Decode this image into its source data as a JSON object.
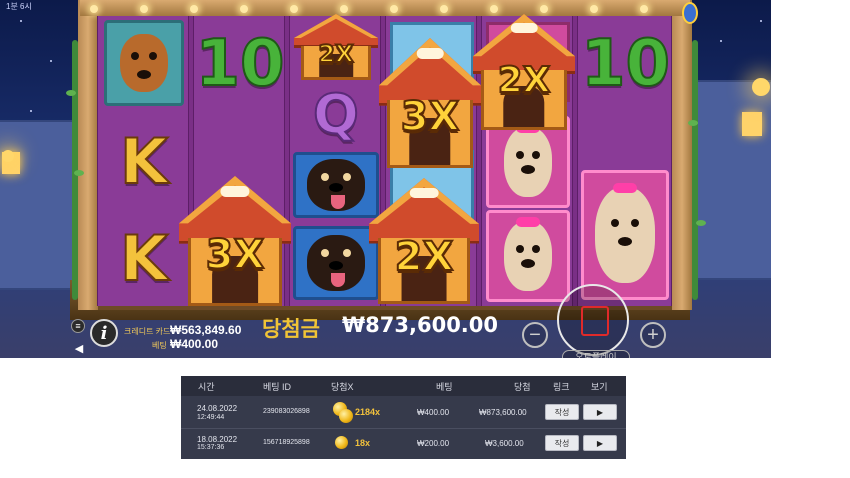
{
  "game": {
    "time_label": "1분 6시",
    "symbols": {
      "ten": "10",
      "k": "K",
      "q": "Q"
    },
    "multipliers": {
      "m2x": "2X",
      "m3x": "3X"
    },
    "hud": {
      "credit_label": "크레디트 카드",
      "credit_value": "₩563,849.60",
      "bet_label": "베팅",
      "bet_value": "₩400.00",
      "win_label": "당첨금",
      "win_value": "₩873,600.00",
      "autoplay_label": "오토플레이",
      "minus": "−",
      "plus": "+",
      "info": "i",
      "menu": "≡",
      "sound": "◀"
    }
  },
  "history": {
    "headers": {
      "time": "시간",
      "bet_id": "베팅 ID",
      "win_x": "당첨X",
      "bet": "베팅",
      "win": "당첨",
      "link": "링크",
      "view": "보기"
    },
    "rows": [
      {
        "date": "24.08.2022",
        "time": "12:49:44",
        "bet_id": "239083026898",
        "multiplier": "2184x",
        "bet": "₩400.00",
        "win": "₩873,600.00",
        "link_label": "작성",
        "view_label": "▶"
      },
      {
        "date": "18.08.2022",
        "time": "15:37:36",
        "bet_id": "156718925898",
        "multiplier": "18x",
        "bet": "₩200.00",
        "win": "₩3,600.00",
        "link_label": "작성",
        "view_label": "▶"
      }
    ]
  },
  "colors": {
    "win_label": "#f1c436",
    "multiplier_gold": "#f3c23c",
    "reel_bg": "#8a3b97",
    "table_bg": "#363a4b",
    "table_head": "#2a2d3b",
    "spin_accent": "#e02a2a"
  }
}
